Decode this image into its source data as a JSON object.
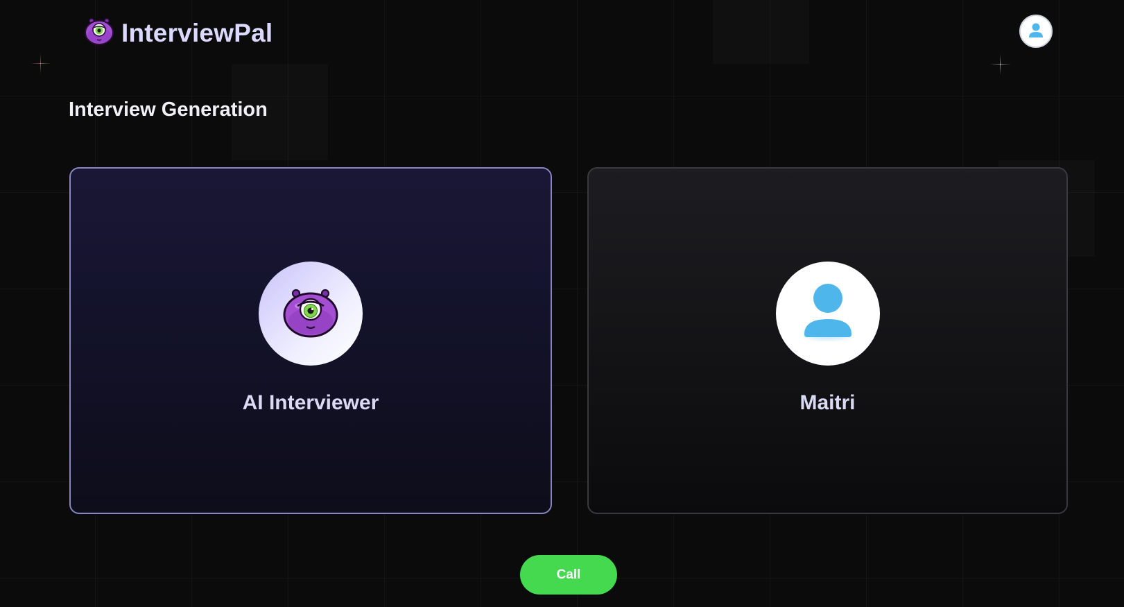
{
  "app": {
    "name": "InterviewPal",
    "logo_icon": "alien-mascot-icon",
    "profile_icon": "user-avatar-icon"
  },
  "page": {
    "title": "Interview Generation"
  },
  "participants": {
    "ai": {
      "name": "AI Interviewer",
      "icon": "alien-mascot-icon"
    },
    "user": {
      "name": "Maitri",
      "icon": "user-avatar-icon"
    }
  },
  "actions": {
    "call_label": "Call"
  },
  "colors": {
    "brand_purple": "#9b4fc9",
    "accent_green": "#45d950",
    "avatar_blue": "#4fb6ec",
    "background": "#0b0b0c"
  }
}
